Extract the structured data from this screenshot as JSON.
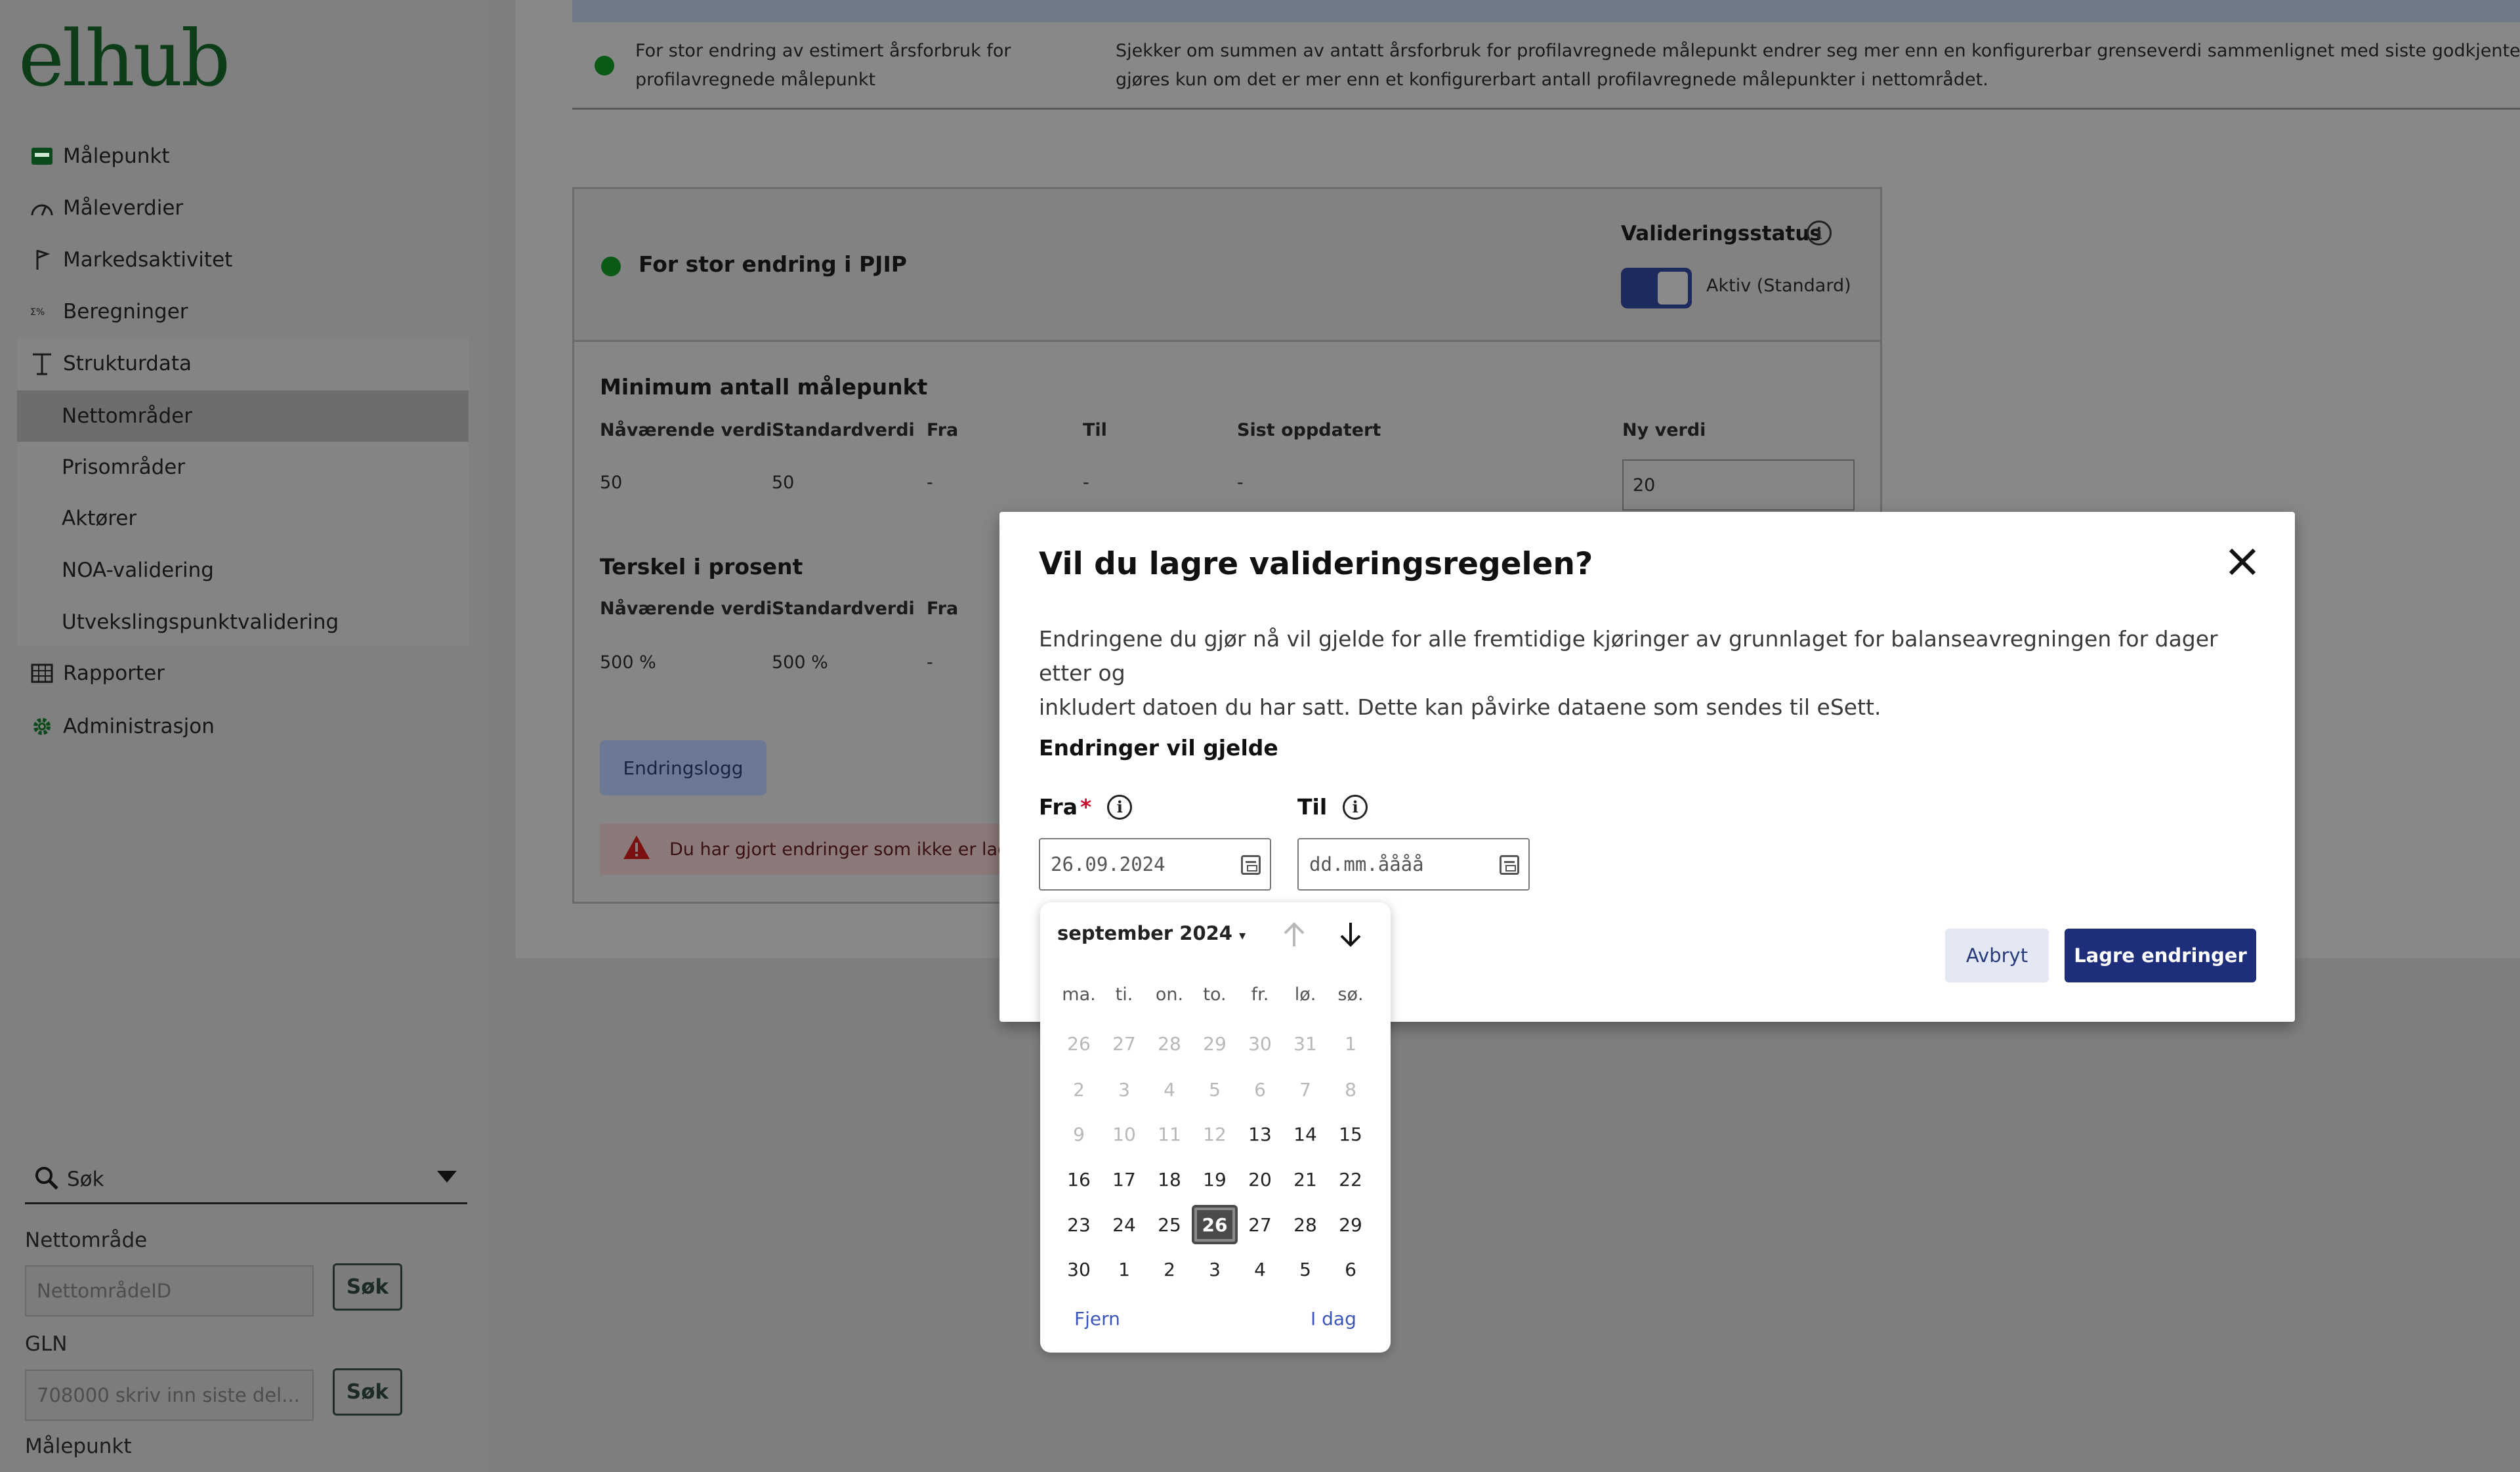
{
  "app": {
    "logo": "elhub"
  },
  "sidebar": {
    "items": [
      {
        "label": "Målepunkt",
        "icon": "meter-card-icon"
      },
      {
        "label": "Måleverdier",
        "icon": "gauge-icon"
      },
      {
        "label": "Markedsaktivitet",
        "icon": "flag-icon"
      },
      {
        "label": "Beregninger",
        "icon": "calc-icon"
      },
      {
        "label": "Strukturdata",
        "icon": "tower-icon"
      },
      {
        "label": "Rapporter",
        "icon": "table-icon"
      },
      {
        "label": "Administrasjon",
        "icon": "gear-icon"
      }
    ],
    "sub_items": [
      {
        "label": "Nettområder",
        "selected": true
      },
      {
        "label": "Prisområder"
      },
      {
        "label": "Aktører"
      },
      {
        "label": "NOA-validering"
      },
      {
        "label": "Utvekslingspunktvalidering"
      }
    ],
    "search": {
      "label": "Søk",
      "nett_label": "Nettområde",
      "nett_placeholder": "NettområdeID",
      "gln_label": "GLN",
      "gln_placeholder": "708000 skriv inn siste del...",
      "malepunkt_label": "Målepunkt",
      "button": "Søk"
    }
  },
  "main": {
    "rule_row": {
      "title_line1": "For stor endring av estimert årsforbruk for",
      "title_line2": "profilavregnede målepunkt",
      "desc_line1": "Sjekker om summen av antatt årsforbruk for profilavregnede målepunkt endrer seg mer enn en konfigurerbar grenseverdi sammenlignet med siste godkjente bala",
      "desc_line2": "gjøres kun om det er mer enn et konfigurerbart antall profilavregnede målepunkter i nettområdet."
    },
    "card": {
      "title": "For stor endring i PJIP",
      "status_label": "Valideringsstatus",
      "status_value": "Aktiv (Standard)",
      "section1": {
        "title": "Minimum antall målepunkt",
        "headers": [
          "Nåværende verdi",
          "Standardverdi",
          "Fra",
          "Til",
          "Sist oppdatert"
        ],
        "values": [
          "50",
          "50",
          "-",
          "-",
          "-"
        ],
        "ny_label": "Ny verdi",
        "ny_value": "20"
      },
      "section2": {
        "title": "Terskel i prosent",
        "headers": [
          "Nåværende verdi",
          "Standardverdi",
          "Fra"
        ],
        "values": [
          "500 %",
          "500 %",
          "-"
        ]
      },
      "log_button": "Endringslogg",
      "warning": "Du har gjort endringer som ikke er lag"
    }
  },
  "modal": {
    "title": "Vil du lagre valideringsregelen?",
    "desc_line1": "Endringene du gjør nå vil gjelde for alle fremtidige kjøringer av grunnlaget for balanseavregningen for dager etter og",
    "desc_line2": "inkludert datoen du har satt. Dette kan påvirke dataene som sendes til eSett.",
    "section": "Endringer vil gjelde",
    "from_label": "Fra",
    "required": "*",
    "from_value": "26.09.2024",
    "to_label": "Til",
    "to_placeholder": "dd.mm.åååå",
    "cancel": "Avbryt",
    "save": "Lagre endringer"
  },
  "picker": {
    "month": "september 2024",
    "weekdays": [
      "ma.",
      "ti.",
      "on.",
      "to.",
      "fr.",
      "lø.",
      "sø."
    ],
    "weeks": [
      [
        "26",
        "27",
        "28",
        "29",
        "30",
        "31",
        "1"
      ],
      [
        "2",
        "3",
        "4",
        "5",
        "6",
        "7",
        "8"
      ],
      [
        "9",
        "10",
        "11",
        "12",
        "13",
        "14",
        "15"
      ],
      [
        "16",
        "17",
        "18",
        "19",
        "20",
        "21",
        "22"
      ],
      [
        "23",
        "24",
        "25",
        "26",
        "27",
        "28",
        "29"
      ],
      [
        "30",
        "1",
        "2",
        "3",
        "4",
        "5",
        "6"
      ]
    ],
    "dim": [
      [
        0,
        1,
        2,
        3,
        4,
        5,
        6
      ],
      [
        0,
        1,
        2,
        3,
        4,
        5,
        6
      ],
      [
        0,
        1,
        2,
        3
      ]
    ],
    "selected": [
      4,
      3
    ],
    "clear": "Fjern",
    "today": "I dag"
  }
}
